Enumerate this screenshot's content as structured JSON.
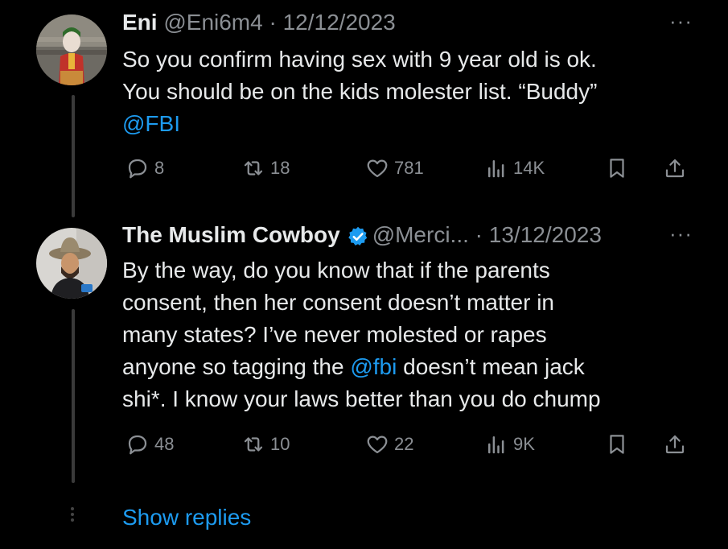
{
  "tweet1": {
    "name": "Eni",
    "handle": "@Eni6m4",
    "separator": " · ",
    "date": "12/12/2023",
    "text_line1": "So you confirm having sex with 9 year old is ok.",
    "text_line2": "You should be on the kids molester list. “Buddy”",
    "mention": "@FBI",
    "more": "···",
    "replies": "8",
    "reposts": "18",
    "likes": "781",
    "views": "14K"
  },
  "tweet2": {
    "name": "The Muslim Cowboy",
    "handle": "@Merci...",
    "separator": " · ",
    "date": "13/12/2023",
    "more": "···",
    "line1": "By the way, do you know that if the parents",
    "line2": "consent, then her consent doesn’t matter in",
    "line3": "many states? I’ve never molested or rapes",
    "line4_before": "anyone so tagging the ",
    "line4_mention": "@fbi",
    "line4_after": " doesn’t mean jack",
    "line5": "shi*. I know your laws better than you do chump",
    "replies": "48",
    "reposts": "10",
    "likes": "22",
    "views": "9K"
  },
  "show_replies": "Show replies",
  "colors": {
    "background": "#000000",
    "text": "#e7e9ea",
    "secondary": "#8b8f94",
    "link": "#1d9bf0",
    "verified": "#1d9bf0"
  },
  "icons": [
    "reply-icon",
    "repost-icon",
    "like-icon",
    "views-icon",
    "bookmark-icon",
    "share-icon",
    "verified-badge-icon",
    "more-icon"
  ]
}
